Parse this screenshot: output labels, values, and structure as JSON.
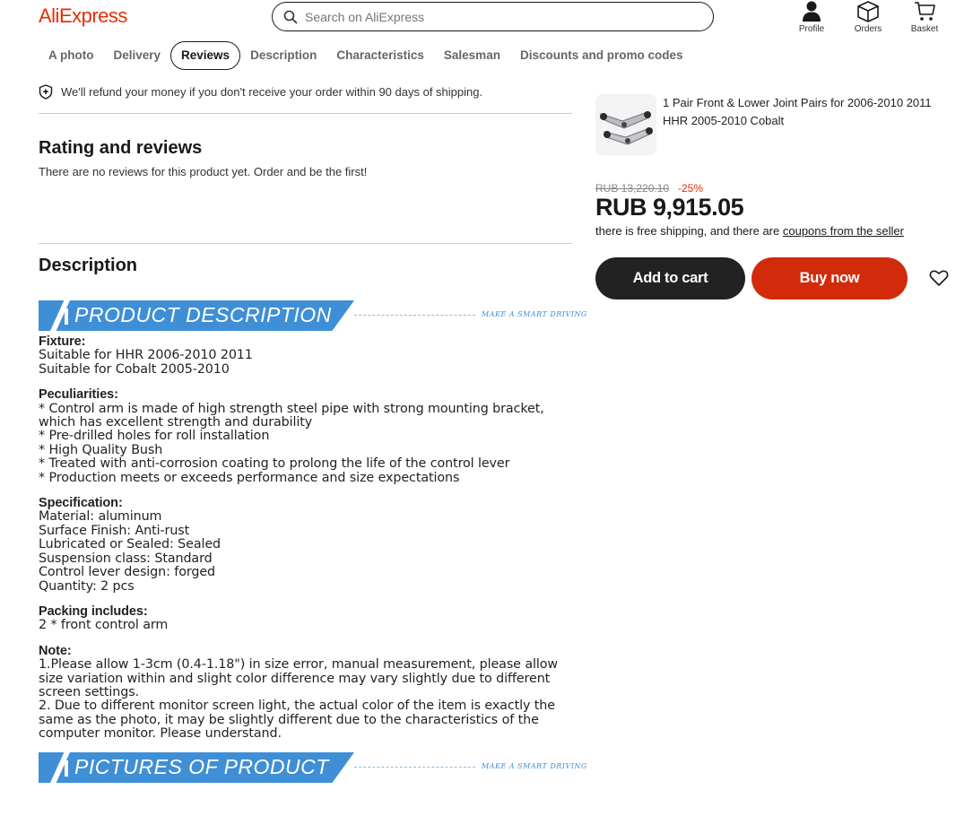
{
  "header": {
    "logo": "AliExpress",
    "search_placeholder": "Search on AliExpress",
    "profile_label": "Profile",
    "orders_label": "Orders",
    "basket_label": "Basket"
  },
  "tabs": [
    {
      "label": "A photo"
    },
    {
      "label": "Delivery"
    },
    {
      "label": "Reviews",
      "active": true
    },
    {
      "label": "Description"
    },
    {
      "label": "Characteristics"
    },
    {
      "label": "Salesman"
    },
    {
      "label": "Discounts and promo codes"
    }
  ],
  "refund_notice": "We'll refund your money if you don't receive your order within 90 days of shipping.",
  "reviews": {
    "title": "Rating and reviews",
    "empty_text": "There are no reviews for this product yet. Order and be the first!"
  },
  "description": {
    "title": "Description",
    "banner1": "PRODUCT DESCRIPTION",
    "banner2": "PICTURES OF PRODUCT",
    "banner_tag": "MAKE A SMART DRIVING",
    "fixture_label": "Fixture:",
    "fixture_lines": [
      "Suitable for HHR 2006-2010 2011",
      "Suitable for Cobalt 2005-2010"
    ],
    "peculiarities_label": "Peculiarities:",
    "peculiarities_lines": [
      "* Control arm is made of high strength steel pipe with strong mounting bracket, which has excellent strength and durability",
      "* Pre-drilled holes for roll installation",
      "* High Quality Bush",
      "* Treated with anti-corrosion coating to prolong the life of the control lever",
      "* Production meets or exceeds performance and size expectations"
    ],
    "specification_label": "Specification:",
    "specification_lines": [
      "Material: aluminum",
      "Surface Finish: Anti-rust",
      "Lubricated or Sealed: Sealed",
      "Suspension class: Standard",
      "Control lever design: forged",
      "Quantity: 2 pcs"
    ],
    "packing_label": "Packing includes:",
    "packing_lines": [
      "2 * front control arm"
    ],
    "note_label": "Note:",
    "note_lines": [
      "1.Please allow 1-3cm (0.4-1.18\") in size error, manual measurement, please allow size variation within and slight color difference may vary slightly due to different screen settings.",
      "2. Due to different monitor screen light, the actual color of the item is exactly the same as the photo, it may be slightly different due to the characteristics of the computer monitor. Please understand."
    ]
  },
  "product": {
    "title": "1 Pair Front & Lower Joint Pairs for 2006-2010 2011 HHR 2005-2010 Cobalt",
    "old_price": "RUB 13,220.10",
    "discount": "-25%",
    "price": "RUB 9,915.05",
    "shipping_text": "there is free shipping, and there are ",
    "coupons_link": "coupons from the seller",
    "add_to_cart": "Add to cart",
    "buy_now": "Buy now"
  },
  "colors": {
    "brand": "#e62e04",
    "buy_button": "#d22b0b",
    "cart_button": "#222222",
    "banner_blue": "#3f8fd6"
  }
}
